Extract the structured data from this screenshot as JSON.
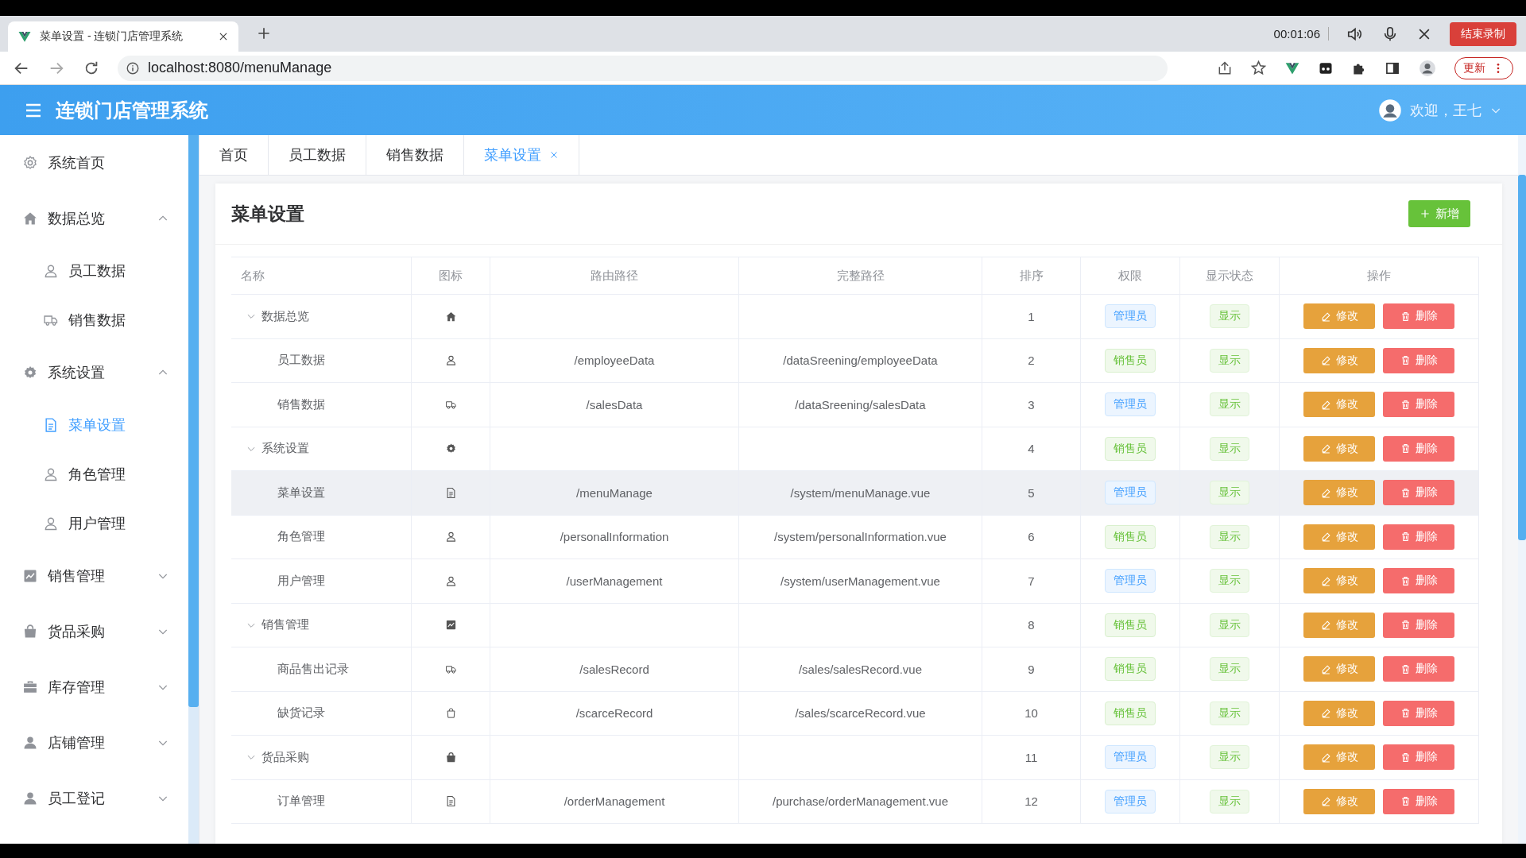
{
  "browser": {
    "tab_title": "菜单设置 - 连锁门店管理系统",
    "recording_timer": "00:01:06",
    "stop_recording_button": "结束录制",
    "address": "localhost:8080/menuManage",
    "update_button": "更新"
  },
  "header": {
    "title": "连锁门店管理系统",
    "welcome": "欢迎，王七"
  },
  "sidebar": {
    "items": [
      {
        "label": "系统首页",
        "kind": "link",
        "selected": false
      },
      {
        "label": "数据总览",
        "kind": "group",
        "expanded": true,
        "selected": false,
        "children": [
          {
            "label": "员工数据",
            "selected": false
          },
          {
            "label": "销售数据",
            "selected": false
          }
        ]
      },
      {
        "label": "系统设置",
        "kind": "group",
        "expanded": true,
        "selected": false,
        "children": [
          {
            "label": "菜单设置",
            "selected": true
          },
          {
            "label": "角色管理",
            "selected": false
          },
          {
            "label": "用户管理",
            "selected": false
          }
        ]
      },
      {
        "label": "销售管理",
        "kind": "group",
        "expanded": false,
        "selected": false
      },
      {
        "label": "货品采购",
        "kind": "group",
        "expanded": false,
        "selected": false
      },
      {
        "label": "库存管理",
        "kind": "group",
        "expanded": false,
        "selected": false
      },
      {
        "label": "店铺管理",
        "kind": "group",
        "expanded": false,
        "selected": false
      },
      {
        "label": "员工登记",
        "kind": "group",
        "expanded": false,
        "selected": false
      }
    ]
  },
  "tabs": [
    {
      "label": "首页",
      "selected": false,
      "closable": false
    },
    {
      "label": "员工数据",
      "selected": false,
      "closable": false
    },
    {
      "label": "销售数据",
      "selected": false,
      "closable": false
    },
    {
      "label": "菜单设置",
      "selected": true,
      "closable": true
    }
  ],
  "card": {
    "title": "菜单设置",
    "add_button": "新增"
  },
  "table": {
    "columns": [
      "名称",
      "图标",
      "路由路径",
      "完整路径",
      "排序",
      "权限",
      "显示状态",
      "操作"
    ],
    "rows": [
      {
        "name": "数据总览",
        "order": "1",
        "role": {
          "label": "管理员",
          "color": "#409eff"
        },
        "status": "显示",
        "actions": [
          "修改",
          "删除"
        ],
        "expanded": true,
        "hovered": false,
        "children": [
          {
            "name": "员工数据",
            "route": "/employeeData",
            "full_path": "/dataSreening/employeeData",
            "order": "2",
            "role": {
              "label": "销售员",
              "color": "#67c23a"
            },
            "status": "显示",
            "actions": [
              "修改",
              "删除"
            ],
            "hovered": false
          },
          {
            "name": "销售数据",
            "route": "/salesData",
            "full_path": "/dataSreening/salesData",
            "order": "3",
            "role": {
              "label": "管理员",
              "color": "#409eff"
            },
            "status": "显示",
            "actions": [
              "修改",
              "删除"
            ],
            "hovered": false
          }
        ]
      },
      {
        "name": "系统设置",
        "order": "4",
        "role": {
          "label": "销售员",
          "color": "#67c23a"
        },
        "status": "显示",
        "actions": [
          "修改",
          "删除"
        ],
        "expanded": true,
        "hovered": false,
        "children": [
          {
            "name": "菜单设置",
            "route": "/menuManage",
            "full_path": "/system/menuManage.vue",
            "order": "5",
            "role": {
              "label": "管理员",
              "color": "#409eff"
            },
            "status": "显示",
            "actions": [
              "修改",
              "删除"
            ],
            "hovered": true
          },
          {
            "name": "角色管理",
            "route": "/personalInformation",
            "full_path": "/system/personalInformation.vue",
            "order": "6",
            "role": {
              "label": "销售员",
              "color": "#67c23a"
            },
            "status": "显示",
            "actions": [
              "修改",
              "删除"
            ],
            "hovered": false
          },
          {
            "name": "用户管理",
            "route": "/userManagement",
            "full_path": "/system/userManagement.vue",
            "order": "7",
            "role": {
              "label": "管理员",
              "color": "#409eff"
            },
            "status": "显示",
            "actions": [
              "修改",
              "删除"
            ],
            "hovered": false
          }
        ]
      },
      {
        "name": "销售管理",
        "order": "8",
        "role": {
          "label": "销售员",
          "color": "#67c23a"
        },
        "status": "显示",
        "actions": [
          "修改",
          "删除"
        ],
        "expanded": true,
        "hovered": false,
        "children": [
          {
            "name": "商品售出记录",
            "route": "/salesRecord",
            "full_path": "/sales/salesRecord.vue",
            "order": "9",
            "role": {
              "label": "销售员",
              "color": "#67c23a"
            },
            "status": "显示",
            "actions": [
              "修改",
              "删除"
            ],
            "hovered": false
          },
          {
            "name": "缺货记录",
            "route": "/scarceRecord",
            "full_path": "/sales/scarceRecord.vue",
            "order": "10",
            "role": {
              "label": "销售员",
              "color": "#67c23a"
            },
            "status": "显示",
            "actions": [
              "修改",
              "删除"
            ],
            "hovered": false
          }
        ]
      },
      {
        "name": "货品采购",
        "order": "11",
        "role": {
          "label": "管理员",
          "color": "#409eff"
        },
        "status": "显示",
        "actions": [
          "修改",
          "删除"
        ],
        "expanded": true,
        "hovered": false,
        "children": [
          {
            "name": "订单管理",
            "route": "/orderManagement",
            "full_path": "/purchase/orderManagement.vue",
            "order": "12",
            "role": {
              "label": "管理员",
              "color": "#409eff"
            },
            "status": "显示",
            "actions": [
              "修改",
              "删除"
            ],
            "hovered": false
          }
        ]
      }
    ]
  }
}
